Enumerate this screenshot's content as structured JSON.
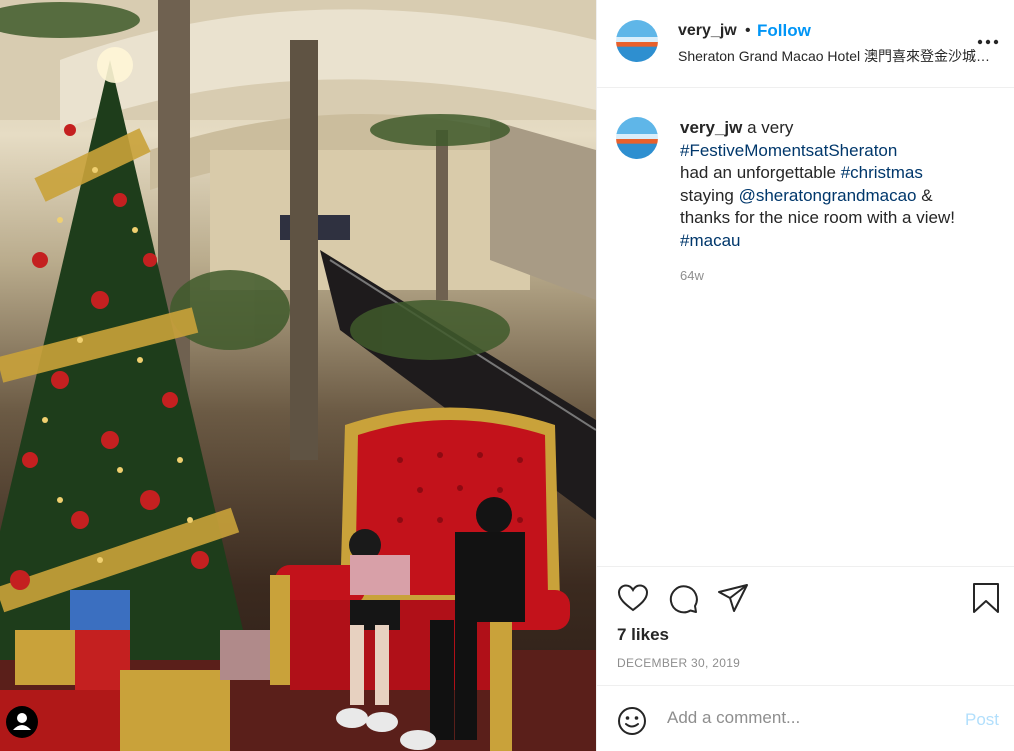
{
  "post": {
    "author": {
      "username": "very_jw"
    },
    "header": {
      "separator": "•",
      "follow_label": "Follow",
      "location": "Sheraton Grand Macao Hotel 澳門喜來登金沙城中心"
    },
    "caption": {
      "username": "very_jw",
      "line1_rest": " a very",
      "tag_festive": "#FestiveMomentsatSheraton",
      "line3_text": "had an unforgettable ",
      "tag_christmas": "#christmas",
      "line4_text": "staying ",
      "mention": "@sheratongrandmacao",
      "line4_rest": " &",
      "line5_text": "thanks for the nice room with a view!",
      "tag_macau": "#macau",
      "age": "64w"
    },
    "engagement": {
      "likes": "7 likes",
      "date": "DECEMBER 30, 2019"
    },
    "comment": {
      "placeholder": "Add a comment...",
      "post_label": "Post"
    }
  },
  "icons": {
    "more": "more-options-icon",
    "like": "heart-icon",
    "comment": "speech-bubble-icon",
    "share": "paper-plane-icon",
    "save": "bookmark-icon",
    "emoji": "smiley-icon",
    "user": "user-icon"
  },
  "colors": {
    "follow_blue": "#0095f6",
    "link_blue": "#00376b",
    "muted_gray": "#8e8e8e",
    "post_disabled": "#b2dffc"
  }
}
